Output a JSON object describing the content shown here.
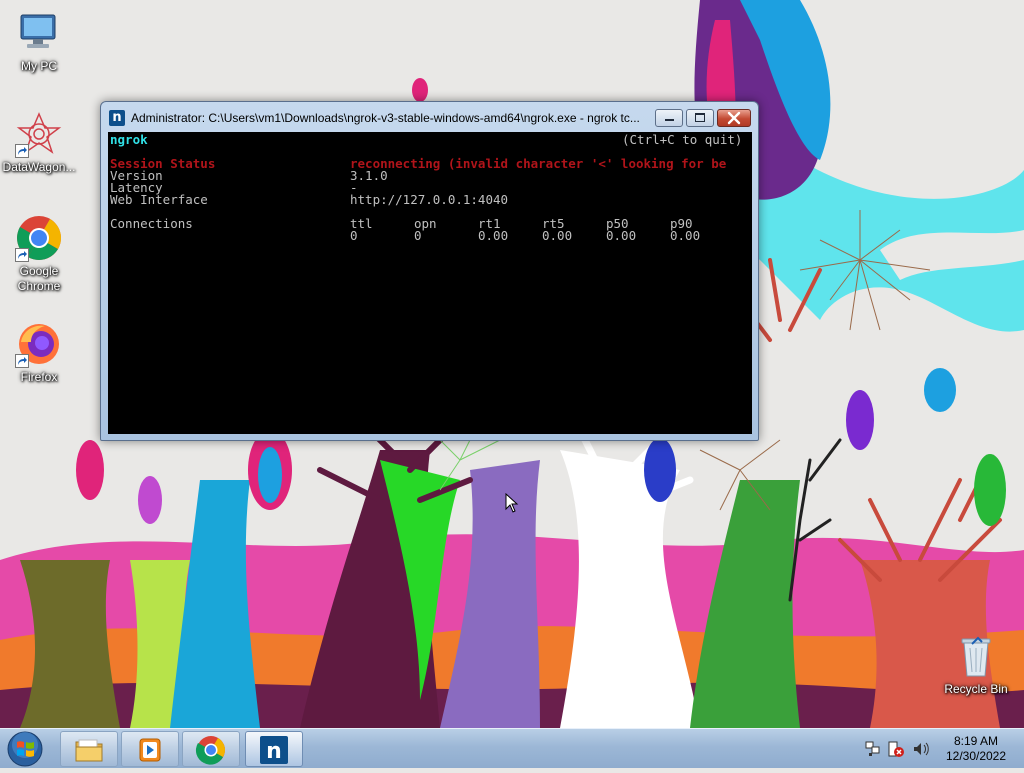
{
  "desktop": {
    "icons": [
      {
        "label": "My PC",
        "icon": "computer-icon"
      },
      {
        "label": "DataWagon...",
        "icon": "datawagon-icon"
      },
      {
        "label": "Google\nChrome",
        "icon": "chrome-icon"
      },
      {
        "label": "Firefox",
        "icon": "firefox-icon"
      },
      {
        "label": "Recycle Bin",
        "icon": "recycle-bin-icon"
      }
    ]
  },
  "window": {
    "title": "Administrator: C:\\Users\\vm1\\Downloads\\ngrok-v3-stable-windows-amd64\\ngrok.exe - ngrok  tc...",
    "app_icon_letter": "n",
    "console": {
      "app_name": "ngrok",
      "quit_hint": "(Ctrl+C to quit)",
      "rows": [
        {
          "label": "Session Status",
          "value": "reconnecting (invalid character '<' looking for be"
        },
        {
          "label": "Version",
          "value": "3.1.0"
        },
        {
          "label": "Latency",
          "value": "-"
        },
        {
          "label": "Web Interface",
          "value": "http://127.0.0.1:4040"
        }
      ],
      "connections": {
        "label": "Connections",
        "headers": [
          "ttl",
          "opn",
          "rt1",
          "rt5",
          "p50",
          "p90"
        ],
        "values": [
          "0",
          "0",
          "0.00",
          "0.00",
          "0.00",
          "0.00"
        ]
      }
    }
  },
  "taskbar": {
    "items": [
      {
        "name": "file-explorer",
        "icon": "folder-icon"
      },
      {
        "name": "media-player",
        "icon": "media-player-icon"
      },
      {
        "name": "chrome",
        "icon": "chrome-icon"
      },
      {
        "name": "ngrok",
        "icon": "ngrok-icon",
        "letter": "n",
        "active": true
      }
    ],
    "tray_icons": [
      "network-icon",
      "action-center-icon",
      "volume-icon"
    ],
    "time": "8:19 AM",
    "date": "12/30/2022"
  },
  "colors": {
    "console_bg": "#000000",
    "console_text": "#c0c0c0",
    "console_cyan": "#30e0e6",
    "console_red": "#b0141a"
  }
}
